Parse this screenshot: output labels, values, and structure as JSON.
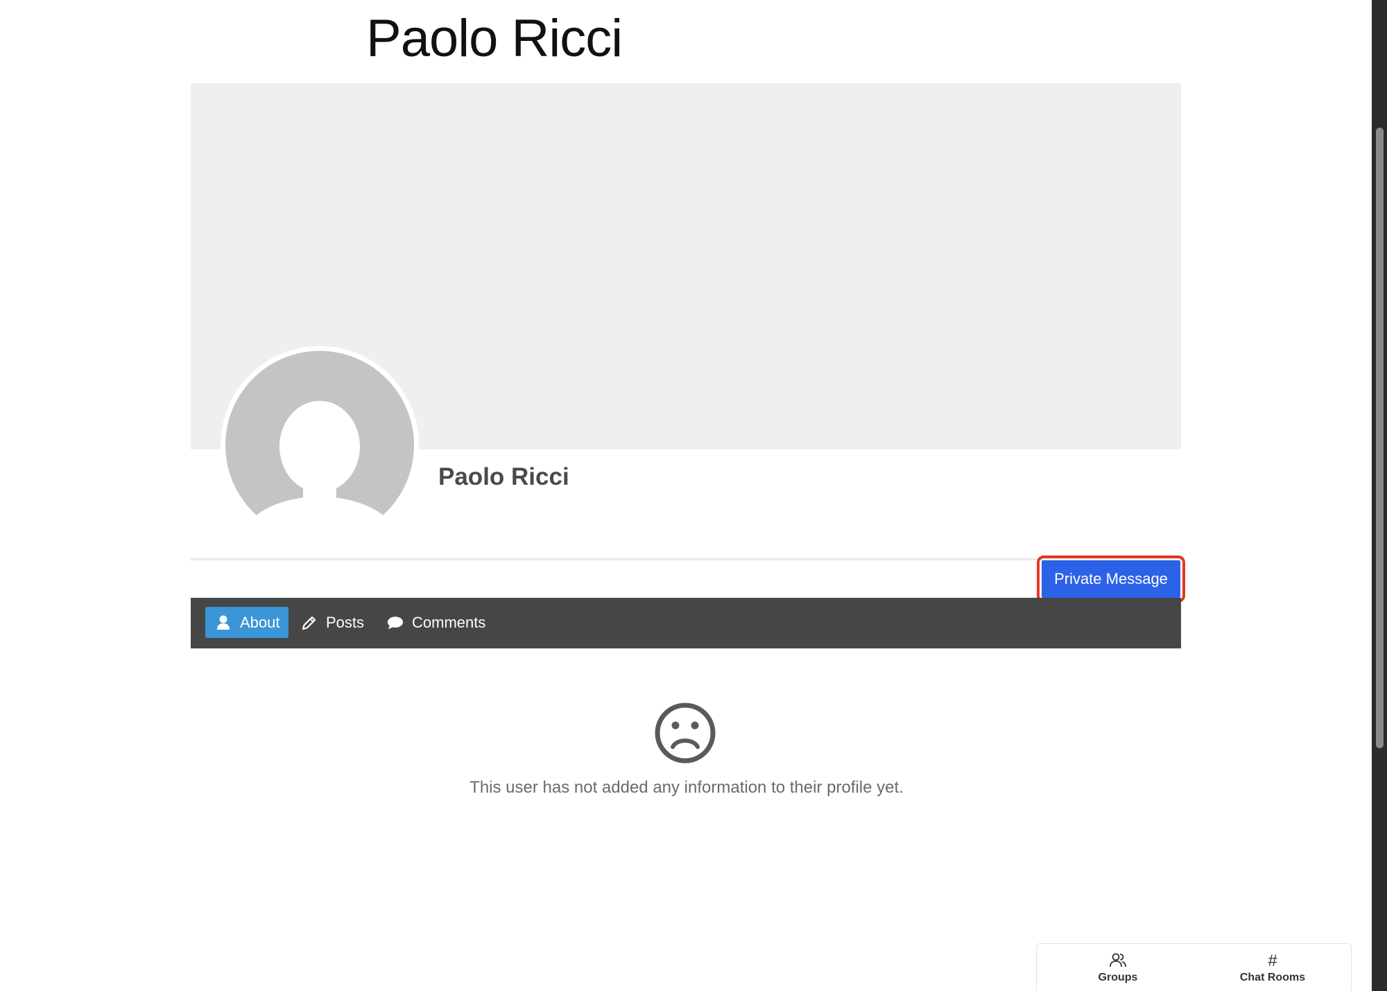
{
  "page": {
    "title": "Paolo Ricci"
  },
  "profile": {
    "name": "Paolo Ricci",
    "private_message_label": "Private Message"
  },
  "tabs": [
    {
      "label": "About",
      "icon": "user-icon",
      "active": true
    },
    {
      "label": "Posts",
      "icon": "pencil-icon",
      "active": false
    },
    {
      "label": "Comments",
      "icon": "comment-icon",
      "active": false
    }
  ],
  "empty_state": {
    "icon": "sad-face-icon",
    "message": "This user has not added any information to their profile yet."
  },
  "dock": {
    "groups_label": "Groups",
    "chat_rooms_label": "Chat Rooms",
    "chat_rooms_icon": "#"
  },
  "colors": {
    "tab_bar": "#464646",
    "active_tab": "#3b95d6",
    "primary_button": "#2c62e8",
    "highlight": "#e5391b"
  }
}
